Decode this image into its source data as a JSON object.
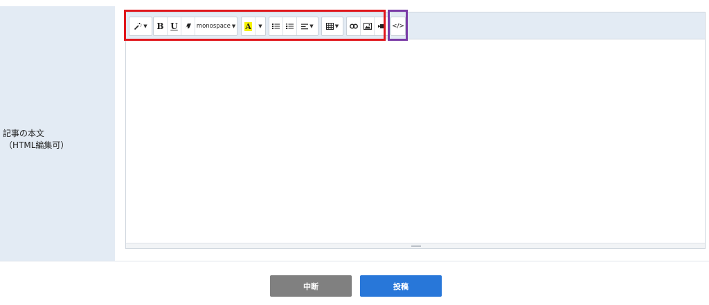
{
  "form": {
    "label_line1": "記事の本文",
    "label_line2": "（HTML編集可）"
  },
  "toolbar": {
    "font_name": "monospace",
    "style_icon": "magic-wand-icon",
    "bold": "B",
    "underline": "U",
    "eraser_icon": "eraser-icon",
    "color_letter": "A",
    "highlight_color": "#f5f200",
    "ul_icon": "unordered-list-icon",
    "ol_icon": "ordered-list-icon",
    "align_icon": "align-left-icon",
    "table_icon": "table-icon",
    "link_icon": "link-icon",
    "picture_icon": "picture-icon",
    "video_icon": "video-icon",
    "codeview": "</>"
  },
  "actions": {
    "cancel_label": "中断",
    "submit_label": "投稿",
    "cancel_color": "#808080",
    "submit_color": "#2877d9"
  }
}
